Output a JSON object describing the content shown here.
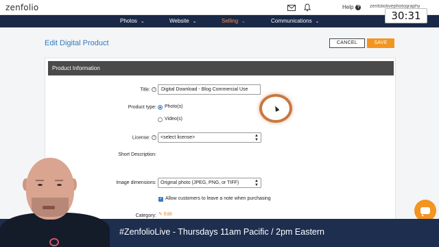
{
  "app": {
    "logo": "zenfolio",
    "help_label": "Help",
    "user_label": "zenfoliolivephotography",
    "timer": "30:31"
  },
  "nav": {
    "items": [
      {
        "label": "Photos",
        "active": false
      },
      {
        "label": "Website",
        "active": false
      },
      {
        "label": "Selling",
        "active": true
      },
      {
        "label": "Communications",
        "active": false
      }
    ]
  },
  "page": {
    "title": "Edit Digital Product",
    "cancel_label": "CANCEL",
    "save_label": "SAVE"
  },
  "form": {
    "section_title": "Product Information",
    "title_label": "Title:",
    "title_value": "Digital Download - Blog Commercial Use",
    "product_type_label": "Product type:",
    "product_type_options": [
      "Photo(s)",
      "Video(s)"
    ],
    "product_type_selected": "Photo(s)",
    "license_label": "License:",
    "license_value": "<select license>",
    "short_description_label": "Short Description:",
    "image_dimensions_label": "Image dimensions:",
    "image_dimensions_value": "Original photo (JPEG, PNG, or TIFF)",
    "allow_note_label": "Allow customers to leave a note when purchasing",
    "allow_note_checked": true,
    "category_label": "Category:",
    "category_edit_label": "Edit"
  },
  "banner": {
    "text": "#ZenfolioLive - Thursdays 11am Pacific / 2pm Eastern"
  },
  "colors": {
    "nav_bg": "#192947",
    "accent_orange": "#f39521",
    "link_blue": "#2e7bbf",
    "banner_bg": "#1d2e4f"
  }
}
